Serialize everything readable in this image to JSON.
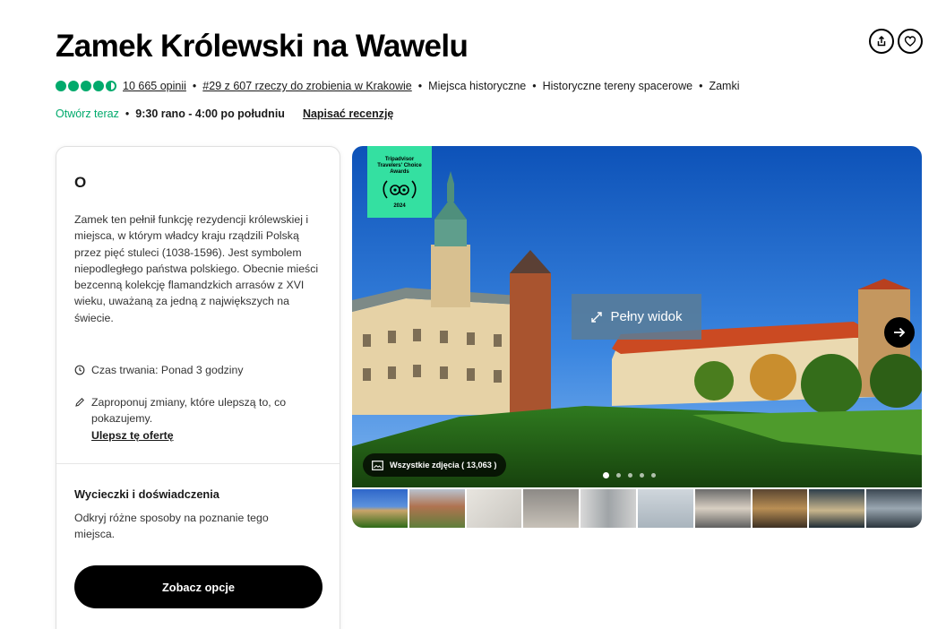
{
  "header": {
    "title": "Zamek Królewski na Wawelu",
    "share_icon": "share-icon",
    "save_icon": "heart-icon"
  },
  "meta": {
    "rating": 4.5,
    "bubble_color": "#00aa6c",
    "reviews_link": "10 665 opinii",
    "ranking_link": "#29 z 607 rzeczy do zrobienia w Krakowie",
    "categories": [
      "Miejsca historyczne",
      "Historyczne tereny spacerowe",
      "Zamki"
    ]
  },
  "hours": {
    "status": "Otwórz teraz",
    "time": "9:30 rano - 4:00 po południu",
    "write_review": "Napisać recenzję"
  },
  "about": {
    "heading": "O",
    "description": "Zamek ten pełnił funkcję rezydencji królewskiej i miejsca, w którym władcy kraju rządzili Polską przez pięć stuleci (1038-1596). Jest symbolem niepodległego państwa polskiego. Obecnie mieści bezcenną kolekcję flamandzkich arrasów z XVI wieku, uważaną za jedną z największych na świecie.",
    "duration": "Czas trwania: Ponad 3 godziny",
    "suggest_text": "Zaproponuj zmiany, które ulepszą to, co pokazujemy.",
    "improve_link": "Ulepsz tę ofertę"
  },
  "tours": {
    "heading": "Wycieczki i doświadczenia",
    "description": "Odkryj różne sposoby na poznanie tego miejsca.",
    "cta": "Zobacz opcje"
  },
  "gallery": {
    "badge_text": "Tripadvisor Travelers' Choice Awards",
    "badge_year": "2024",
    "badge_color": "#34e0a1",
    "full_view": "Pełny widok",
    "all_photos": "Wszystkie zdjęcia ( 13,063 )",
    "page_dots": 5,
    "active_dot": 1,
    "thumbnails": 10
  }
}
